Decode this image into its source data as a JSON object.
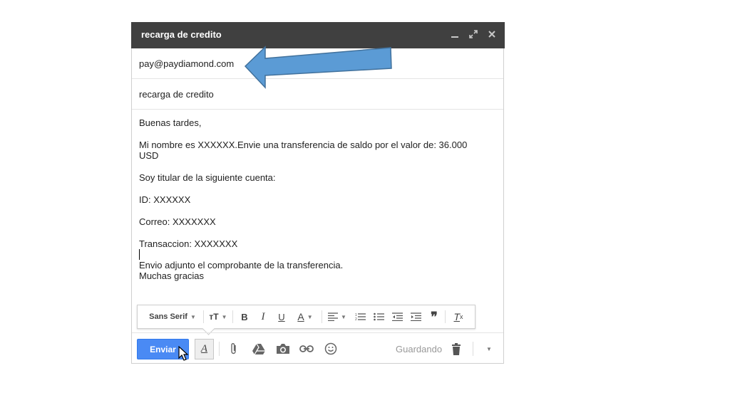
{
  "compose": {
    "title": "recarga de credito",
    "to": "pay@paydiamond.com",
    "subject": "recarga de credito",
    "body": {
      "greeting": "Buenas tardes,",
      "line1": "Mi nombre es XXXXXX.Envie una transferencia de saldo por el valor de: 36.000",
      "line1b": "USD",
      "line2": "Soy titular de la siguiente cuenta:",
      "line3": "ID: XXXXXX",
      "line4": "Correo: XXXXXXX",
      "line5": "Transaccion: XXXXXXX",
      "line6": "Envio adjunto el comprobante de la transferencia.",
      "line7": "Muchas gracias"
    }
  },
  "titlebar_icons": [
    "minimize-icon",
    "expand-icon",
    "close-icon"
  ],
  "format_toolbar": {
    "font": "Sans Serif",
    "items": [
      "text-size-icon",
      "bold-icon",
      "italic-icon",
      "underline-icon",
      "text-color-icon",
      "align-icon",
      "numbered-list-icon",
      "bulleted-list-icon",
      "indent-less-icon",
      "indent-more-icon",
      "quote-icon",
      "remove-formatting-icon"
    ]
  },
  "bottom_bar": {
    "send_label": "Enviar",
    "status": "Guardando",
    "icons": [
      "formatting-icon",
      "attach-icon",
      "drive-icon",
      "photo-icon",
      "link-icon",
      "emoji-icon",
      "trash-icon",
      "more-options-icon"
    ]
  },
  "colors": {
    "titlebar_bg": "#404040",
    "send_button": "#4a8af4",
    "annotation_arrow": "#5b9bd5"
  }
}
